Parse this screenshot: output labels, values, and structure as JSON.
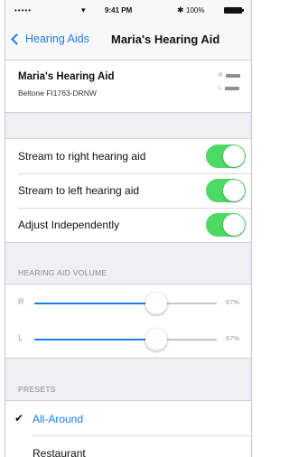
{
  "status_bar": {
    "signal": "•••••",
    "time": "9:41 PM",
    "battery_text": "100%"
  },
  "nav": {
    "back_label": "Hearing Aids",
    "title": "Maria's Hearing Aid"
  },
  "device": {
    "name": "Maria's Hearing Aid",
    "model": "Beltone FI1763-DRNW",
    "right_label": "R",
    "left_label": "L"
  },
  "toggles": [
    {
      "label": "Stream to right hearing aid",
      "on": true
    },
    {
      "label": "Stream to left hearing aid",
      "on": true
    },
    {
      "label": "Adjust Independently",
      "on": true
    }
  ],
  "volume": {
    "header": "HEARING AID VOLUME",
    "sliders": [
      {
        "side": "R",
        "value": 0.67,
        "value_text": "67%"
      },
      {
        "side": "L",
        "value": 0.67,
        "value_text": "67%"
      }
    ]
  },
  "presets": {
    "header": "PRESETS",
    "items": [
      {
        "label": "All-Around",
        "selected": true
      },
      {
        "label": "Restaurant",
        "selected": false
      }
    ]
  },
  "colors": {
    "accent": "#1b7cf2",
    "switch_on": "#4cd964"
  }
}
